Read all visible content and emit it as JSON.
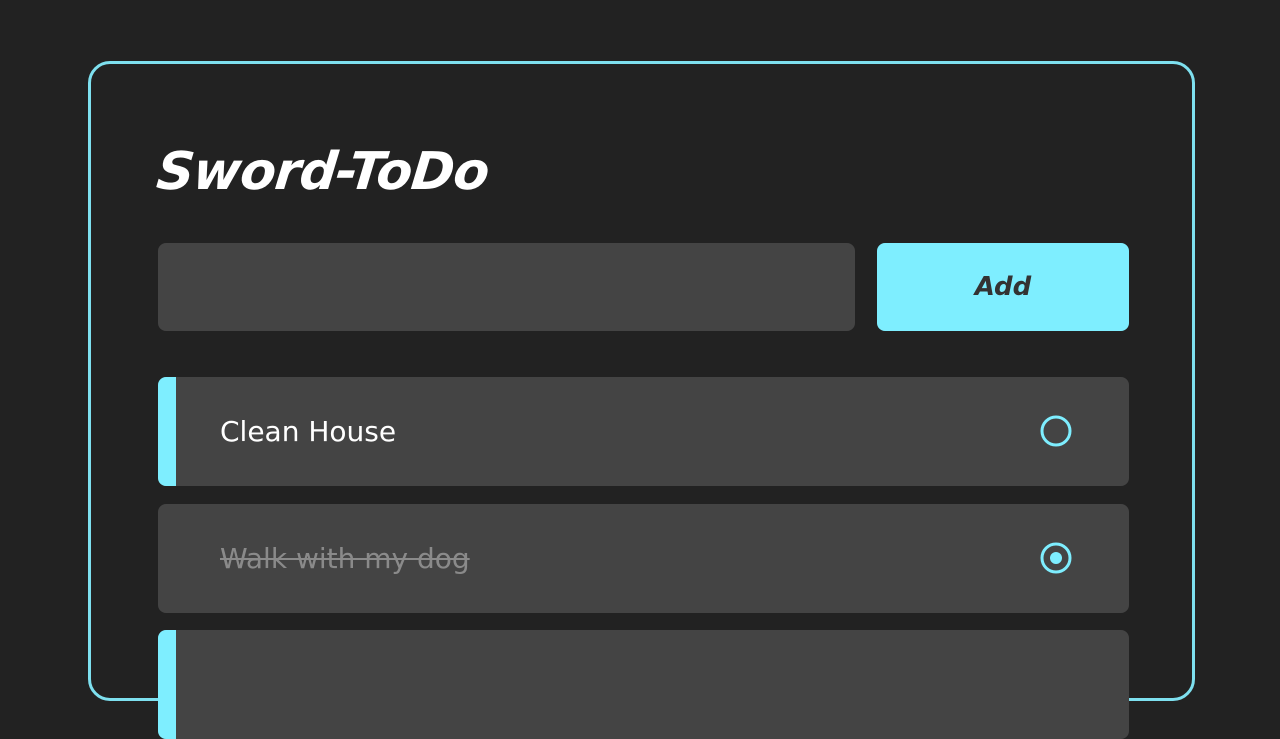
{
  "app": {
    "title": "Sword-ToDo"
  },
  "form": {
    "input_value": "",
    "input_placeholder": "",
    "add_label": "Add"
  },
  "todos": [
    {
      "text": "Clean House",
      "completed": false
    },
    {
      "text": "Walk with my dog",
      "completed": true
    },
    {
      "text": "",
      "completed": false
    }
  ],
  "theme": {
    "background": "#222222",
    "accent": "#7eeeff",
    "item_background": "#444444",
    "text": "#ffffff",
    "completed_text": "#8a8a8a"
  },
  "icons": {
    "unchecked": "radio-unchecked-icon",
    "checked": "radio-checked-icon"
  }
}
